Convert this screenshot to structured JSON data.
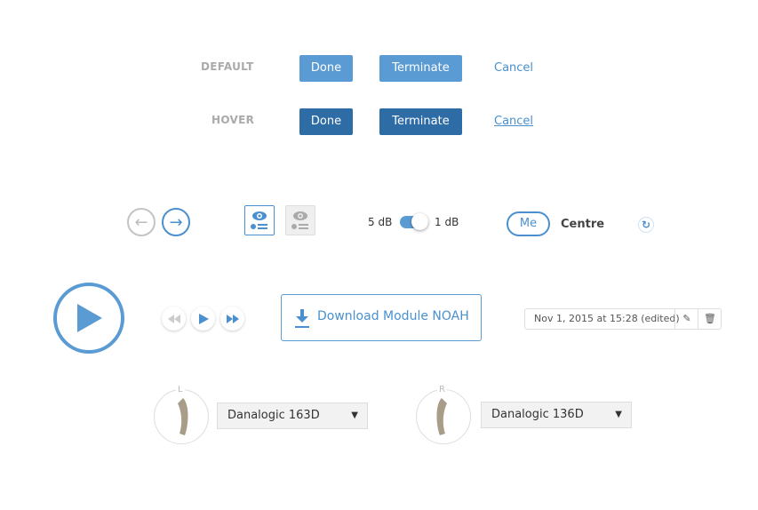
{
  "states": [
    {
      "label": "DEFAULT",
      "done": "Done",
      "terminate": "Terminate",
      "cancel": "Cancel"
    },
    {
      "label": "HOVER",
      "done": "Done",
      "terminate": "Terminate",
      "cancel": "Cancel"
    }
  ],
  "toggle": {
    "left": "5 dB",
    "right": "1 dB",
    "on": true
  },
  "segment": {
    "selected": "Me",
    "other": "Centre"
  },
  "download": {
    "label": "Download Module NOAH"
  },
  "timestamp": {
    "text": "Nov 1, 2015 at 15:28 (edited)"
  },
  "devices": [
    {
      "side": "L",
      "model": "Danalogic 163D"
    },
    {
      "side": "R",
      "model": "Danalogic 136D"
    }
  ],
  "colors": {
    "primary": "#5b9bd3",
    "hover": "#2e6ca5",
    "link": "#4a90cf"
  }
}
